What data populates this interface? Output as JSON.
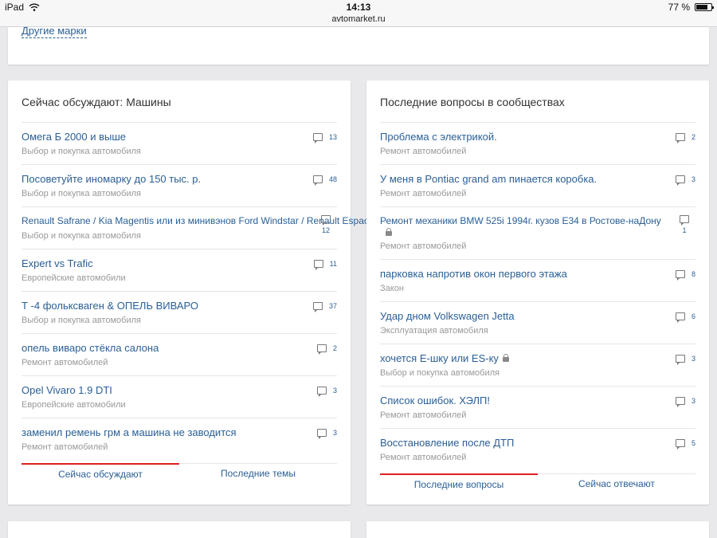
{
  "status": {
    "device": "iPad",
    "time": "14:13",
    "battery": "77 %",
    "battery_level": 0.77
  },
  "address": {
    "domain": "avtomarket.ru"
  },
  "top": {
    "other_brands": "Другие марки"
  },
  "left": {
    "title": "Сейчас обсуждают: Машины",
    "items": [
      {
        "title": "Омега Б 2000 и выше",
        "sub": "Выбор и покупка автомобиля",
        "count": "13"
      },
      {
        "title": "Посоветуйте иномарку до 150 тыс. р.",
        "sub": "Выбор и покупка автомобиля",
        "count": "48"
      },
      {
        "title": "Renault Safrane / Kia Magentis или из минивэнов Ford Windstar / Renault Espace",
        "sub": "Выбор и покупка автомобиля",
        "count": "12"
      },
      {
        "title": "Expert vs Trafic",
        "sub": "Европейские автомобили",
        "count": "11"
      },
      {
        "title": "Т -4 фольксваген & ОПЕЛЬ ВИВАРО",
        "sub": "Выбор и покупка автомобиля",
        "count": "37"
      },
      {
        "title": "опель виваро стёкла салона",
        "sub": "Ремонт автомобилей",
        "count": "2"
      },
      {
        "title": "Opel Vivaro 1.9 DTI",
        "sub": "Европейские автомобили",
        "count": "3"
      },
      {
        "title": "заменил ремень грм а машина не заводится",
        "sub": "Ремонт автомобилей",
        "count": "3"
      }
    ],
    "tabs": [
      "Сейчас обсуждают",
      "Последние темы"
    ]
  },
  "right": {
    "title": "Последние вопросы в сообществах",
    "items": [
      {
        "title": "Проблема с электрикой.",
        "sub": "Ремонт автомобилей",
        "count": "2"
      },
      {
        "title": "У меня в Pontiac grand am пинается коробка.",
        "sub": "Ремонт автомобилей",
        "count": "3"
      },
      {
        "title": "Ремонт механики BMW 525i 1994г. кузов E34 в Ростове-наДону",
        "sub": "Ремонт автомобилей",
        "count": "1"
      },
      {
        "title": "парковка напротив окон первого этажа",
        "sub": "Закон",
        "count": "8"
      },
      {
        "title": "Удар дном Volkswagen Jetta",
        "sub": "Эксплуатация автомобиля",
        "count": "6"
      },
      {
        "title": "хочется Е-шку или ES-ку",
        "sub": "Выбор и покупка автомобиля",
        "count": "3"
      },
      {
        "title": "Список ошибок. ХЭЛП!",
        "sub": "Ремонт автомобилей",
        "count": "3"
      },
      {
        "title": "Восстановление после ДТП",
        "sub": "Ремонт автомобилей",
        "count": "5"
      }
    ],
    "tabs": [
      "Последние вопросы",
      "Сейчас отвечают"
    ]
  },
  "colors": {
    "link": "#2a5f96",
    "accent": "#e02020",
    "muted": "#999999",
    "background": "#e9e9ec"
  },
  "icons": {
    "comment": "comment-bubble-icon",
    "lock": "lock-icon",
    "wifi": "wifi-icon",
    "battery": "battery-icon"
  }
}
